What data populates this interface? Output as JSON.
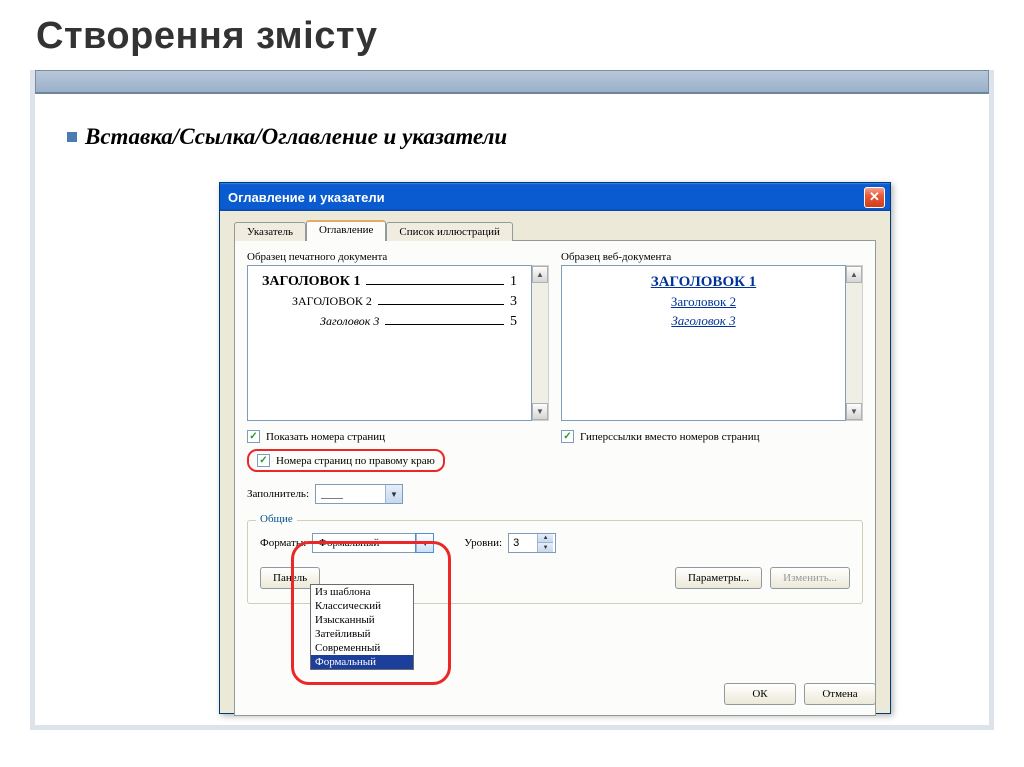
{
  "slide": {
    "title": "Створення змісту",
    "bullet": "Вставка/Ссылка/Оглавление и указатели"
  },
  "dialog": {
    "title": "Оглавление и указатели",
    "tabs": [
      "Указатель",
      "Оглавление",
      "Список иллюстраций"
    ],
    "tab_u_idx": [
      0,
      0,
      9
    ],
    "print_label": "Образец печатного документа",
    "web_label": "Образец веб-документа",
    "print_preview": [
      {
        "text": "ЗАГОЛОВОК 1",
        "page": "1"
      },
      {
        "text": "ЗАГОЛОВОК 2",
        "page": "3"
      },
      {
        "text": "Заголовок 3",
        "page": "5"
      }
    ],
    "web_preview": [
      "ЗАГОЛОВОК 1",
      "Заголовок 2",
      "Заголовок 3"
    ],
    "chk_show_pages": "Показать номера страниц",
    "chk_right_align": "Номера страниц по правому краю",
    "chk_hyperlinks": "Гиперссылки вместо номеров страниц",
    "filler_label": "Заполнитель:",
    "filler_value": "____",
    "group": "Общие",
    "formats_label": "Форматы:",
    "formats_value": "Формальный",
    "formats_options": [
      "Из шаблона",
      "Классический",
      "Изысканный",
      "Затейливый",
      "Современный",
      "Формальный"
    ],
    "levels_label": "Уровни:",
    "levels_value": "3",
    "panel_btn": "Панель",
    "params_btn": "Параметры...",
    "modify_btn": "Изменить...",
    "ok": "ОК",
    "cancel": "Отмена"
  }
}
